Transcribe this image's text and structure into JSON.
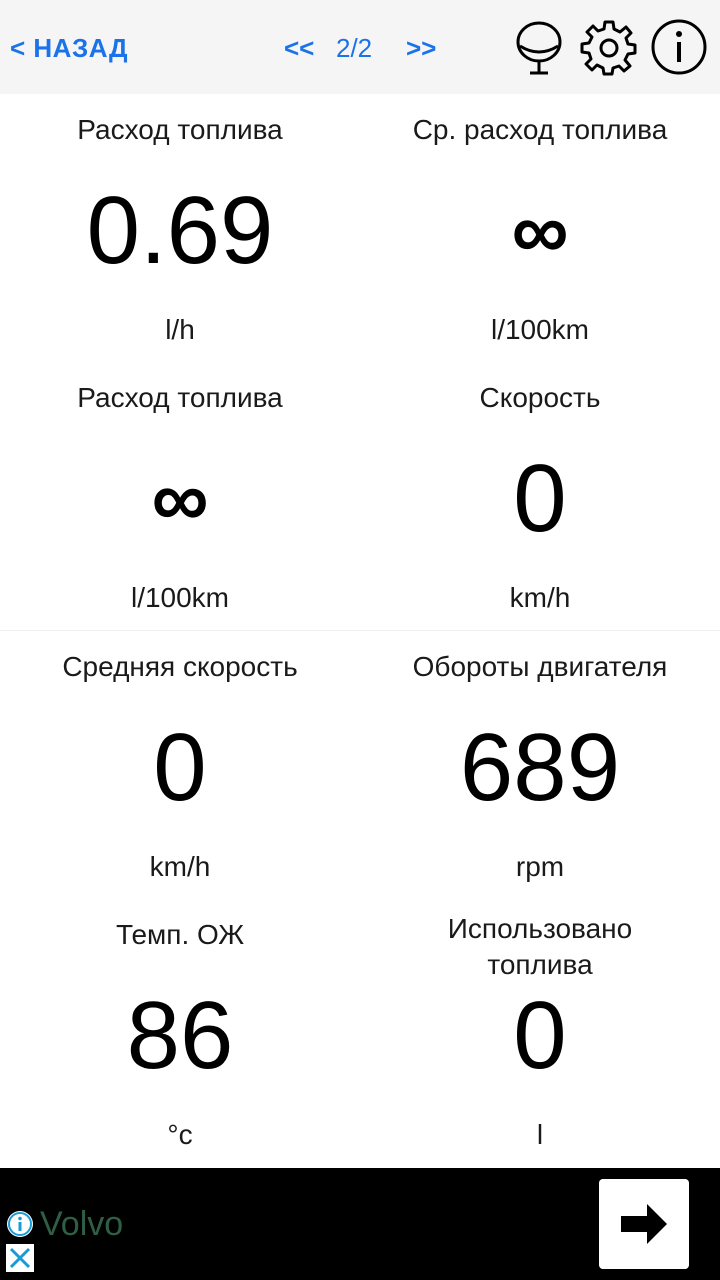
{
  "header": {
    "back_label": "< НАЗАД",
    "prev_label": "<<",
    "page_label": "2/2",
    "next_label": ">>"
  },
  "metrics": [
    {
      "label": "Расход топлива",
      "value": "0.69",
      "unit": "l/h"
    },
    {
      "label": "Ср. расход топлива",
      "value": "∞",
      "unit": "l/100km"
    },
    {
      "label": "Расход топлива",
      "value": "∞",
      "unit": "l/100km"
    },
    {
      "label": "Скорость",
      "value": "0",
      "unit": "km/h"
    },
    {
      "label": "Средняя скорость",
      "value": "0",
      "unit": "km/h"
    },
    {
      "label": "Обороты двигателя",
      "value": "689",
      "unit": "rpm"
    },
    {
      "label": "Темп. ОЖ",
      "value": "86",
      "unit": "°c"
    },
    {
      "label": "Использовано топлива",
      "value": "0",
      "unit": "l"
    }
  ],
  "ad": {
    "title": "Volvo"
  },
  "colors": {
    "accent": "#1a73e8",
    "ad_background": "#000000",
    "ad_text": "#2f5e45"
  }
}
